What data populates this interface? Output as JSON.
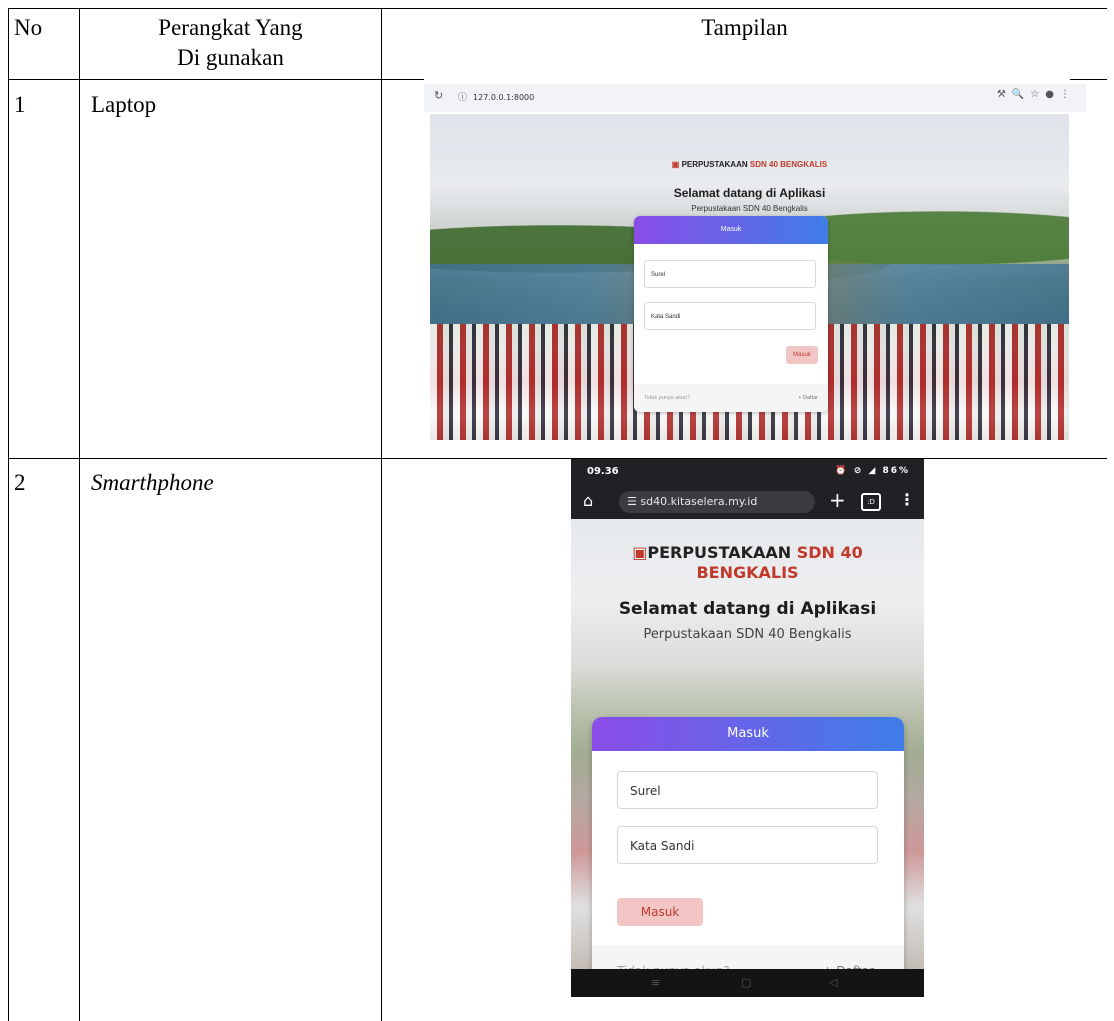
{
  "table": {
    "headers": {
      "no": "No",
      "device_line1": "Perangkat Yang",
      "device_line2": "Di gunakan",
      "display": "Tampilan"
    },
    "rows": [
      {
        "no": "1",
        "device": "Laptop"
      },
      {
        "no": "2",
        "device": "Smarthphone"
      }
    ]
  },
  "laptop": {
    "url": "127.0.0.1:8000",
    "brand_prefix": "PERPUSTAKAAN ",
    "brand_accent": "SDN 40 BENGKALIS",
    "title": "Selamat datang di Aplikasi",
    "subtitle": "Perpustakaan SDN 40 Bengkalis",
    "card_header": "Masuk",
    "email_placeholder": "Surel",
    "password_placeholder": "Kata Sandi",
    "submit_label": "Masuk",
    "no_account": "Tidak punya akun?",
    "register_label": "+ Daftar"
  },
  "phone": {
    "time": "09.36",
    "battery": "86%",
    "url": "sd40.kitaselera.my.id",
    "brand_prefix": "PERPUSTAKAAN ",
    "brand_accent_1": "SDN 40",
    "brand_accent_2": "BENGKALIS",
    "title": "Selamat datang di Aplikasi",
    "subtitle": "Perpustakaan SDN 40 Bengkalis",
    "card_header": "Masuk",
    "email_placeholder": "Surel",
    "password_placeholder": "Kata Sandi",
    "submit_label": "Masuk",
    "no_account": "Tidak punya akun?",
    "register_label": "+ Daftar"
  },
  "colors": {
    "brand_red": "#c0392b",
    "gradient_start": "#8a4de8",
    "gradient_end": "#3f7de8",
    "button_bg": "#f3c6c6"
  }
}
